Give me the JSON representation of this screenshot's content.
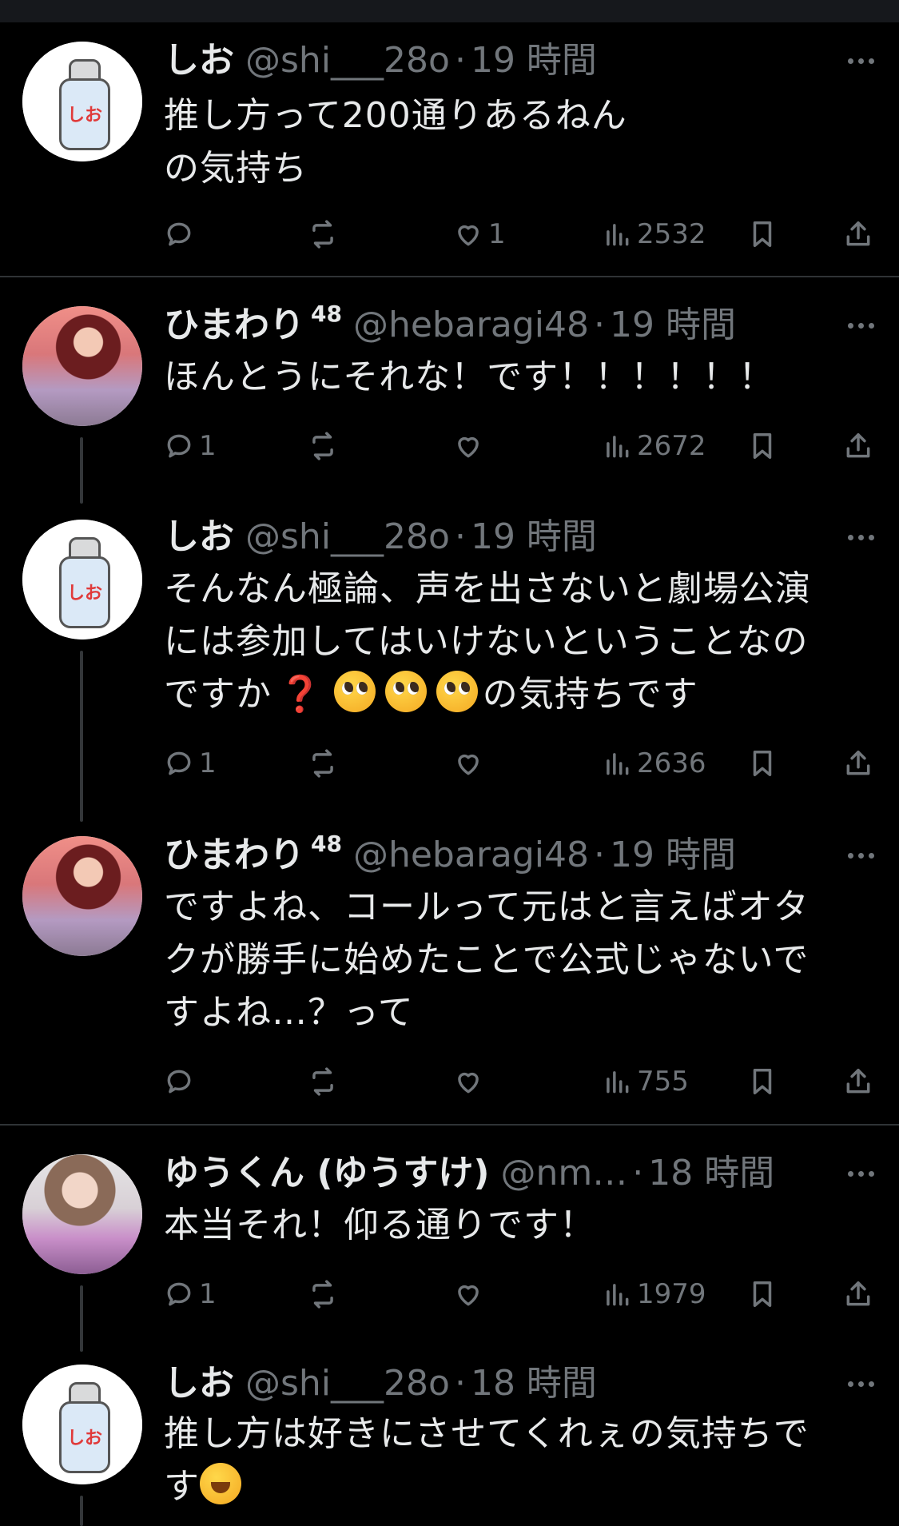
{
  "tweets": [
    {
      "name": "しお",
      "badge": "",
      "handle": "@shi___28o",
      "time": "19 時間",
      "text": "推し方って200通りあるねん\nの気持ち",
      "avatar": "salt",
      "counts": {
        "reply": "",
        "retweet": "",
        "like": "1",
        "views": "2532"
      }
    },
    {
      "name": "ひまわり",
      "badge": "48",
      "handle": "@hebaragi48",
      "time": "19 時間",
      "text": "ほんとうにそれな！です！！！！！！",
      "avatar": "photo1",
      "counts": {
        "reply": "1",
        "retweet": "",
        "like": "",
        "views": "2672"
      }
    },
    {
      "name": "しお",
      "badge": "",
      "handle": "@shi___28o",
      "time": "19 時間",
      "text_line1": "そんなん極論、声を出さないと劇場公演",
      "text_line2": "には参加してはいけないということなの",
      "text_line3a": "ですか",
      "text_q": "❓",
      "text_line3b": "の気持ちです",
      "avatar": "salt",
      "counts": {
        "reply": "1",
        "retweet": "",
        "like": "",
        "views": "2636"
      }
    },
    {
      "name": "ひまわり",
      "badge": "48",
      "handle": "@hebaragi48",
      "time": "19 時間",
      "text": "ですよね、コールって元はと言えばオタ\nクが勝手に始めたことで公式じゃないで\nすよね…？って",
      "avatar": "photo1",
      "counts": {
        "reply": "",
        "retweet": "",
        "like": "",
        "views": "755"
      }
    },
    {
      "name": "ゆうくん (ゆうすけ)",
      "badge": "",
      "handle": "@nm…",
      "time": "18 時間",
      "text": "本当それ！仰る通りです！",
      "avatar": "photo2",
      "counts": {
        "reply": "1",
        "retweet": "",
        "like": "",
        "views": "1979"
      }
    },
    {
      "name": "しお",
      "badge": "",
      "handle": "@shi___28o",
      "time": "18 時間",
      "text_line1": "推し方は好きにさせてくれぇの気持ちで",
      "text_line2": "す",
      "avatar": "salt",
      "counts": {
        "reply": "",
        "retweet": "",
        "like": "",
        "views": ""
      }
    }
  ],
  "salt_label": "しお",
  "icons": [
    "reply-icon",
    "retweet-icon",
    "like-icon",
    "views-icon",
    "bookmark-icon",
    "share-icon",
    "more-icon"
  ],
  "colors": {
    "background": "#000000",
    "text": "#e7e9ea",
    "muted": "#71767b",
    "divider": "#2f3336"
  }
}
